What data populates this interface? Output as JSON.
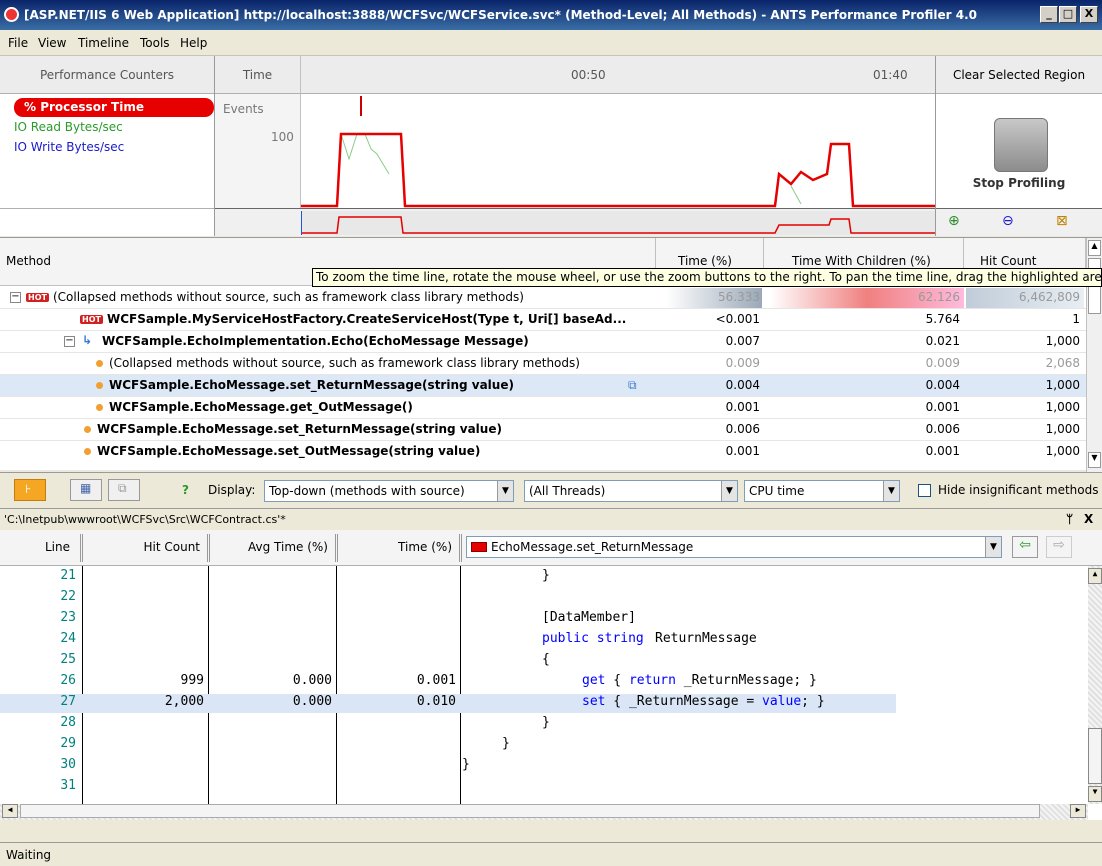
{
  "window": {
    "title": "[ASP.NET/IIS 6 Web Application] http://localhost:3888/WCFSvc/WCFService.svc* (Method-Level; All Methods) - ANTS Performance Profiler 4.0",
    "buttons": {
      "minimize": "_",
      "maximize": "□",
      "close": "X"
    }
  },
  "menu": [
    "File",
    "View",
    "Timeline",
    "Tools",
    "Help"
  ],
  "counters": {
    "header": "Performance Counters",
    "items": [
      "% Processor Time",
      "IO Read Bytes/sec",
      "IO Write Bytes/sec"
    ]
  },
  "timeline": {
    "time_label": "Time",
    "events_label": "Events",
    "tick_0050": "00:50",
    "tick_0140": "01:40",
    "y_max": "100",
    "clear_region": "Clear Selected Region",
    "stop_profiling": "Stop Profiling",
    "colors": {
      "cpu": "#e60000",
      "io_read": "#2a9a2a",
      "io_write": "#1a1acc"
    }
  },
  "grid": {
    "columns": {
      "method": "Method",
      "time": "Time (%)",
      "time_children": "Time With Children (%)",
      "hit_count": "Hit Count"
    },
    "tooltip": "To zoom the time line, rotate the mouse wheel, or use the zoom buttons to the right. To pan the time line, drag the highlighted area",
    "rows": [
      {
        "name": "(Collapsed methods without source, such as framework class library methods)",
        "time": "56.333",
        "twc": "62.126",
        "hits": "6,462,809"
      },
      {
        "name": "WCFSample.MyServiceHostFactory.CreateServiceHost(Type t, Uri[] baseAd...",
        "time": "<0.001",
        "twc": "5.764",
        "hits": "1"
      },
      {
        "name": "WCFSample.EchoImplementation.Echo(EchoMessage Message)",
        "time": "0.007",
        "twc": "0.021",
        "hits": "1,000"
      },
      {
        "name": "(Collapsed methods without source, such as framework class library methods)",
        "time": "0.009",
        "twc": "0.009",
        "hits": "2,068"
      },
      {
        "name": "WCFSample.EchoMessage.set_ReturnMessage(string value)",
        "time": "0.004",
        "twc": "0.004",
        "hits": "1,000"
      },
      {
        "name": "WCFSample.EchoMessage.get_OutMessage()",
        "time": "0.001",
        "twc": "0.001",
        "hits": "1,000"
      },
      {
        "name": "WCFSample.EchoMessage.set_ReturnMessage(string value)",
        "time": "0.006",
        "twc": "0.006",
        "hits": "1,000"
      },
      {
        "name": "WCFSample.EchoMessage.set_OutMessage(string value)",
        "time": "0.001",
        "twc": "0.001",
        "hits": "1,000"
      }
    ]
  },
  "toolbar": {
    "display_label": "Display:",
    "display_value": "Top-down (methods with source)",
    "threads_value": "(All Threads)",
    "time_value": "CPU time",
    "hide_label": "Hide insignificant methods"
  },
  "source": {
    "path": "'C:\\Inetpub\\wwwroot\\WCFSvc\\Src\\WCFContract.cs'*",
    "pin": "ᛘ",
    "close": "X",
    "columns": {
      "line": "Line",
      "hit_count": "Hit Count",
      "avg_time": "Avg Time (%)",
      "time": "Time (%)"
    },
    "method_combo": "EchoMessage.set_ReturnMessage",
    "lines": [
      {
        "num": "21",
        "hits": "",
        "avg": "",
        "time": "",
        "code": "}"
      },
      {
        "num": "22",
        "hits": "",
        "avg": "",
        "time": "",
        "code": ""
      },
      {
        "num": "23",
        "hits": "",
        "avg": "",
        "time": "",
        "code": "[DataMember]"
      },
      {
        "num": "24",
        "hits": "",
        "avg": "",
        "time": "",
        "code": "public string ReturnMessage"
      },
      {
        "num": "25",
        "hits": "",
        "avg": "",
        "time": "",
        "code": "{"
      },
      {
        "num": "26",
        "hits": "999",
        "avg": "0.000",
        "time": "0.001",
        "code": "get { return _ReturnMessage; }"
      },
      {
        "num": "27",
        "hits": "2,000",
        "avg": "0.000",
        "time": "0.010",
        "code": "set { _ReturnMessage = value; }"
      },
      {
        "num": "28",
        "hits": "",
        "avg": "",
        "time": "",
        "code": "}"
      },
      {
        "num": "29",
        "hits": "",
        "avg": "",
        "time": "",
        "code": "}"
      },
      {
        "num": "30",
        "hits": "",
        "avg": "",
        "time": "",
        "code": "}"
      },
      {
        "num": "31",
        "hits": "",
        "avg": "",
        "time": "",
        "code": ""
      }
    ]
  },
  "status": "Waiting"
}
